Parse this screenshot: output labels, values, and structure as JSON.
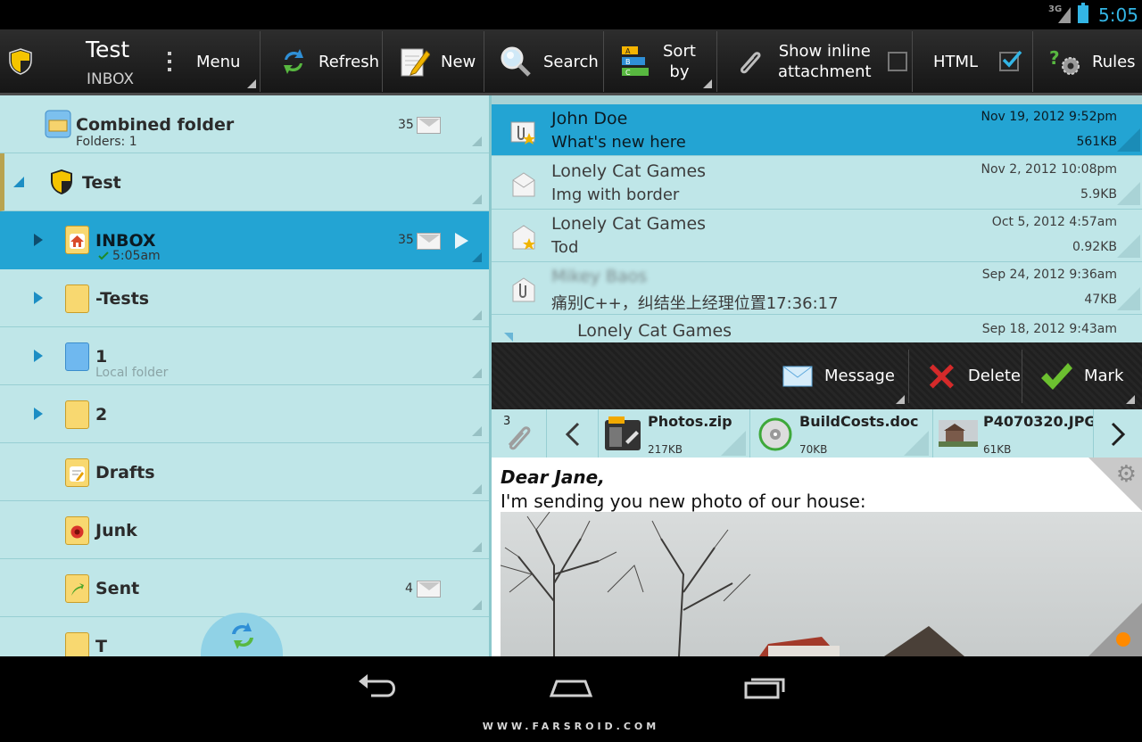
{
  "status": {
    "network": "3G",
    "time": "5:05"
  },
  "actionbar": {
    "title": "Test",
    "subtitle": "INBOX",
    "menu": "Menu",
    "refresh": "Refresh",
    "new": "New",
    "search": "Search",
    "sort_line1": "Sort",
    "sort_line2": "by",
    "inline_line1": "Show inline",
    "inline_line2": "attachment",
    "inline_checked": false,
    "html": "HTML",
    "html_checked": true,
    "rules": "Rules"
  },
  "folders": [
    {
      "name": "Combined folder",
      "sub": "Folders: 1",
      "count": "35",
      "icon": "combined-folder-icon"
    },
    {
      "name": "Test",
      "icon": "shield-icon",
      "expanded": true
    },
    {
      "name": "INBOX",
      "sub": "5:05am",
      "count": "35",
      "icon": "inbox-home-icon",
      "selected": true
    },
    {
      "name": "-Tests",
      "icon": "folder-icon"
    },
    {
      "name": "1",
      "sub": "Local folder",
      "icon": "local-folder-icon"
    },
    {
      "name": "2",
      "icon": "folder-icon"
    },
    {
      "name": "Drafts",
      "icon": "drafts-icon"
    },
    {
      "name": "Junk",
      "icon": "junk-icon"
    },
    {
      "name": "Sent",
      "count": "4",
      "icon": "sent-icon"
    },
    {
      "name": "T",
      "icon": "folder-icon"
    }
  ],
  "messages": [
    {
      "from": "John Doe",
      "subject": "What's new here",
      "date": "Nov 19, 2012 9:52pm",
      "size": "561KB",
      "selected": true
    },
    {
      "from": "Lonely Cat Games",
      "subject": "Img with border",
      "date": "Nov 2, 2012 10:08pm",
      "size": "5.9KB"
    },
    {
      "from": "Lonely Cat Games",
      "subject": "Tod",
      "date": "Oct 5, 2012 4:57am",
      "size": "0.92KB"
    },
    {
      "from": "Mikey Baos",
      "subject": "痛别C++，纠结坐上经理位置17:36:17",
      "date": "Sep 24, 2012 9:36am",
      "size": "47KB"
    },
    {
      "from": "Lonely Cat Games",
      "subject": "",
      "date": "Sep 18, 2012 9:43am",
      "size": ""
    }
  ],
  "msgtoolbar": {
    "message": "Message",
    "delete": "Delete",
    "mark": "Mark"
  },
  "attachments": {
    "count": "3",
    "items": [
      {
        "name": "Photos.zip",
        "size": "217KB"
      },
      {
        "name": "BuildCosts.doc",
        "size": "70KB"
      },
      {
        "name": "P4070320.JPG",
        "size": "61KB"
      }
    ]
  },
  "body": {
    "greeting": "Dear Jane,",
    "line1": "I'm sending you new photo of our house:"
  },
  "watermark": "WWW.FARSROID.COM",
  "colors": {
    "accent": "#23a4d3",
    "pane_bg": "#bfe6e8",
    "clock": "#33b5e5"
  }
}
